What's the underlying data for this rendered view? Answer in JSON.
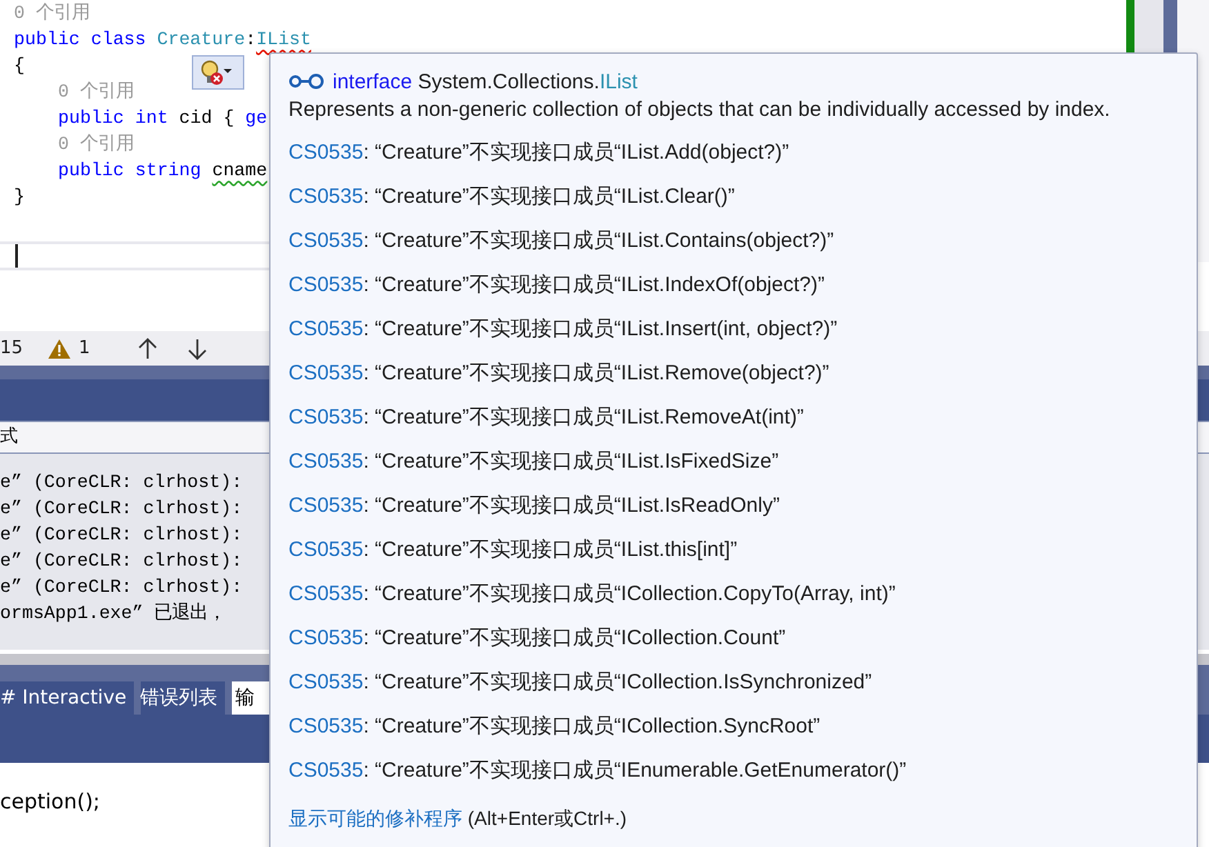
{
  "editor": {
    "lines": [
      {
        "tokens": [
          {
            "text": "0 个引用",
            "kind": "ref"
          }
        ]
      },
      {
        "tokens": [
          {
            "text": "public class ",
            "kind": "keyword"
          },
          {
            "text": "Creature",
            "kind": "type"
          },
          {
            "text": ":",
            "kind": "plain"
          },
          {
            "text": "IList",
            "kind": "type-error"
          }
        ]
      },
      {
        "tokens": [
          {
            "text": "{",
            "kind": "plain"
          }
        ],
        "children": [
          {
            "tokens": [
              {
                "text": "0 个引用",
                "kind": "ref"
              }
            ]
          },
          {
            "tokens": [
              {
                "text": "public int ",
                "kind": "keyword"
              },
              {
                "text": "cid { ",
                "kind": "plain"
              },
              {
                "text": "ge",
                "kind": "keyword"
              }
            ]
          },
          {
            "tokens": [
              {
                "text": "0 个引用",
                "kind": "ref"
              }
            ]
          },
          {
            "tokens": [
              {
                "text": "public string ",
                "kind": "keyword"
              },
              {
                "text": "cname",
                "kind": "warning"
              }
            ]
          }
        ]
      },
      {
        "tokens": [
          {
            "text": "}",
            "kind": "plain"
          }
        ]
      }
    ]
  },
  "status_bar": {
    "errors": "15",
    "warnings": "1"
  },
  "output": {
    "toolbar_label": "式",
    "lines": [
      "e” (CoreCLR: clrhost):",
      "e” (CoreCLR: clrhost):",
      "e” (CoreCLR: clrhost):",
      "e” (CoreCLR: clrhost):",
      "e” (CoreCLR: clrhost):",
      "ormsApp1.exe” 已退出，"
    ]
  },
  "bottom_tabs": [
    {
      "label": "# Interactive",
      "selected": false
    },
    {
      "label": "错误列表",
      "selected": false
    },
    {
      "label": "输",
      "selected": true
    }
  ],
  "code_below": "ception();",
  "quick_info": {
    "keyword": "interface",
    "namespace": "System.Collections.",
    "name": "IList",
    "description": "Represents a non-generic collection of objects that can be individually accessed by index.",
    "diagnostics": [
      {
        "code": "CS0535",
        "message": ": “Creature”不实现接口成员“IList.Add(object?)”"
      },
      {
        "code": "CS0535",
        "message": ": “Creature”不实现接口成员“IList.Clear()”"
      },
      {
        "code": "CS0535",
        "message": ": “Creature”不实现接口成员“IList.Contains(object?)”"
      },
      {
        "code": "CS0535",
        "message": ": “Creature”不实现接口成员“IList.IndexOf(object?)”"
      },
      {
        "code": "CS0535",
        "message": ": “Creature”不实现接口成员“IList.Insert(int, object?)”"
      },
      {
        "code": "CS0535",
        "message": ": “Creature”不实现接口成员“IList.Remove(object?)”"
      },
      {
        "code": "CS0535",
        "message": ": “Creature”不实现接口成员“IList.RemoveAt(int)”"
      },
      {
        "code": "CS0535",
        "message": ": “Creature”不实现接口成员“IList.IsFixedSize”"
      },
      {
        "code": "CS0535",
        "message": ": “Creature”不实现接口成员“IList.IsReadOnly”"
      },
      {
        "code": "CS0535",
        "message": ": “Creature”不实现接口成员“IList.this[int]”"
      },
      {
        "code": "CS0535",
        "message": ": “Creature”不实现接口成员“ICollection.CopyTo(Array, int)”"
      },
      {
        "code": "CS0535",
        "message": ": “Creature”不实现接口成员“ICollection.Count”"
      },
      {
        "code": "CS0535",
        "message": ": “Creature”不实现接口成员“ICollection.IsSynchronized”"
      },
      {
        "code": "CS0535",
        "message": ": “Creature”不实现接口成员“ICollection.SyncRoot”"
      },
      {
        "code": "CS0535",
        "message": ": “Creature”不实现接口成员“IEnumerable.GetEnumerator()”"
      }
    ],
    "fix_link": "显示可能的修补程序",
    "fix_shortcut": " (Alt+Enter或Ctrl+.)"
  }
}
